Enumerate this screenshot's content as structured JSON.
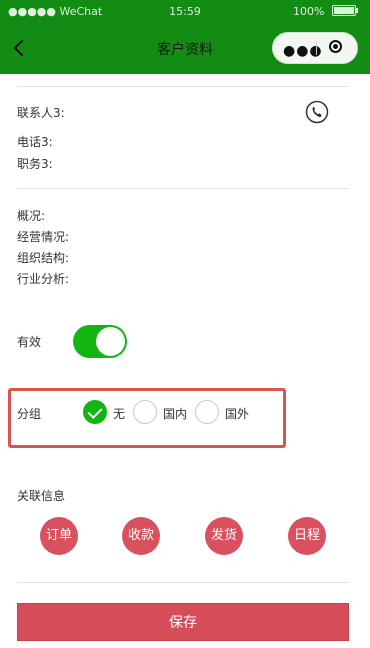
{
  "status_bar": {
    "carrier": "●●●●● WeChat",
    "time": "15:59",
    "battery": "100%"
  },
  "navbar": {
    "title": "客户资料",
    "more_icon": "more-dots-icon",
    "close_icon": "target-close-icon"
  },
  "contact": {
    "contact_label": "联系人3:",
    "phone_label": "电话3:",
    "position_label": "职务3:",
    "phone_icon": "phone-icon"
  },
  "overview": {
    "overview_label": "概况:",
    "operation_label": "经营情况:",
    "org_label": "组织结构:",
    "industry_label": "行业分析:"
  },
  "valid": {
    "label": "有效",
    "on": true,
    "color": "#13b513"
  },
  "group": {
    "label": "分组",
    "options": [
      {
        "label": "无",
        "checked": true
      },
      {
        "label": "国内",
        "checked": false
      },
      {
        "label": "国外",
        "checked": false
      }
    ],
    "highlight_color": "#d9534f"
  },
  "related": {
    "label": "关联信息",
    "buttons": [
      "订单",
      "收款",
      "发货",
      "日程"
    ],
    "color": "#d9505f"
  },
  "save_button": "保存",
  "colors": {
    "header_bg": "#128c12",
    "save_bg": "#d64d5a"
  }
}
